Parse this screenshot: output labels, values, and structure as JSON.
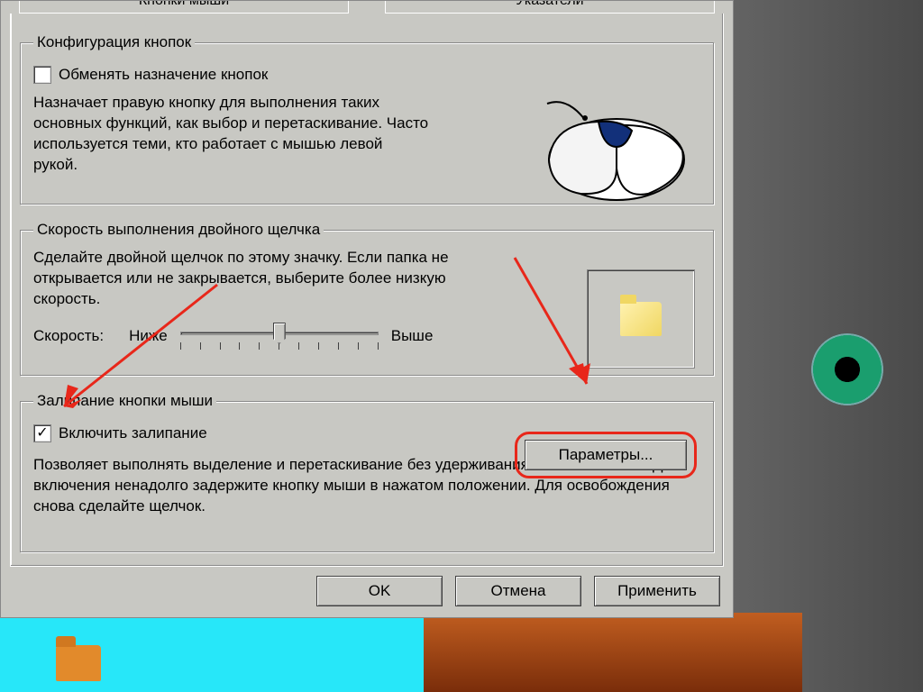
{
  "tabs": {
    "buttons": "Кнопки мыши",
    "pointers": "Указатели"
  },
  "group1": {
    "title": "Конфигурация кнопок",
    "swap_label": "Обменять назначение кнопок",
    "swap_checked": false,
    "desc": "Назначает правую кнопку для выполнения таких основных функций, как выбор и перетаскивание. Часто используется теми, кто работает с мышью левой рукой."
  },
  "group2": {
    "title": "Скорость выполнения двойного щелчка",
    "desc": "Сделайте двойной щелчок по этому значку. Если папка не открывается или не закрывается, выберите более низкую скорость.",
    "speed_label": "Скорость:",
    "slow": "Ниже",
    "fast": "Выше"
  },
  "group3": {
    "title": "Залипание кнопки мыши",
    "lock_label": "Включить залипание",
    "lock_checked": true,
    "params_btn": "Параметры...",
    "desc": "Позволяет выполнять выделение и перетаскивание без удерживания кнопки нажатой. Для включения ненадолго задержите кнопку мыши в нажатом положении. Для освобождения снова сделайте щелчок."
  },
  "buttons": {
    "ok": "OK",
    "cancel": "Отмена",
    "apply": "Применить"
  },
  "annotations": {
    "highlight_color": "#e8271a"
  }
}
